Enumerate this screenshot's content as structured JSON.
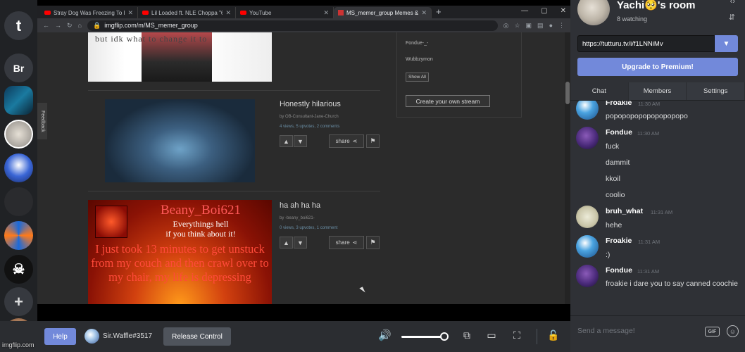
{
  "servers": [
    {
      "id": "tutturu",
      "label": "t",
      "bg": "#36393f"
    },
    {
      "id": "br",
      "label": "Br",
      "bg": "#36393f"
    }
  ],
  "browser": {
    "tabs": [
      {
        "label": "Stray Dog Was Freezing To D"
      },
      {
        "label": "Lil Loaded ft. NLE Choppa \"6"
      },
      {
        "label": "YouTube"
      },
      {
        "label": "MS_memer_group Memes &"
      }
    ],
    "new_tab": "+",
    "win_min": "—",
    "win_max": "▢",
    "win_close": "✕",
    "url": "imgflip.com/m/MS_memer_group",
    "feedback": "Feedback"
  },
  "page": {
    "top_image_text": "but idk what to change it to",
    "top_image_credit": "imgflip.com",
    "posts": [
      {
        "title": "Honestly hilarious",
        "by": "by OB-Consultant-Jane-Church",
        "stats": "4 views, 5 upvotes, 2 comments",
        "share": "share"
      },
      {
        "title": "ha ah ha ha",
        "by": "by -beany_boi621-",
        "stats": "0 views, 3 upvotes, 1 comment",
        "share": "share"
      }
    ],
    "beany": {
      "line1": "Beany_Boi621",
      "line2": "Everythings hell",
      "line3": "if you think about it!",
      "line4": "I just took 13 minutes to get unstuck from my couch and then crawl over to my chair, my life is depressing"
    },
    "sidebar": {
      "items": [
        "Fondue-_-",
        "Wubbzymon"
      ],
      "show_all": "Show All",
      "create": "Create your own stream"
    }
  },
  "controls": {
    "help": "Help",
    "user_name": "Sir.Waffle#3517",
    "release": "Release Control",
    "volume_level": 0.9
  },
  "room": {
    "title": "Yachi🥺's room",
    "watching": "8 watching",
    "url_value": "https://tutturu.tv/i/f1LNNiMv",
    "upgrade": "Upgrade to Premium!",
    "tabs": [
      "Chat",
      "Members",
      "Settings"
    ],
    "active_tab": "Chat",
    "messages": [
      {
        "name": "Froakie",
        "time": "11:30 AM",
        "lines": [
          "popopopopopopopopopo"
        ],
        "avatar": "froakie"
      },
      {
        "name": "Fondue",
        "time": "11:30 AM",
        "lines": [
          "fuck",
          "dammit",
          "kkoil",
          "coolio"
        ],
        "avatar": "fondue"
      },
      {
        "name": "bruh_what",
        "time": "11:31 AM",
        "lines": [
          "hehe"
        ],
        "avatar": "bruh"
      },
      {
        "name": "Froakie",
        "time": "11:31 AM",
        "lines": [
          ":)"
        ],
        "avatar": "froakie"
      },
      {
        "name": "Fondue",
        "time": "11:31 AM",
        "lines": [
          "froakie i dare you to say canned coochie"
        ],
        "avatar": "fondue"
      }
    ],
    "send_placeholder": "Send a message!",
    "gif": "GIF"
  },
  "watermark": "imgflip.com",
  "colors": {
    "accent": "#7289da",
    "bg": "#2f3136",
    "rail": "#202225"
  }
}
